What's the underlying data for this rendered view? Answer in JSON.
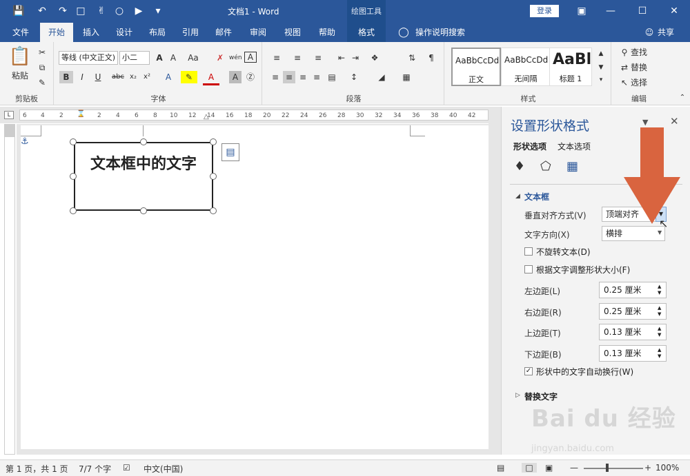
{
  "titlebar": {
    "title": "文档1  -  Word",
    "context_label": "绘图工具",
    "login": "登录",
    "quick_access": [
      "save-icon",
      "undo-icon",
      "redo-icon",
      "new-doc-icon",
      "touch-mode-icon",
      "shape-icon",
      "select-icon",
      "more-icon"
    ]
  },
  "tabs": [
    "文件",
    "开始",
    "插入",
    "设计",
    "布局",
    "引用",
    "邮件",
    "审阅",
    "视图",
    "帮助",
    "格式"
  ],
  "tell_me": "操作说明搜索",
  "share": "共享",
  "ribbon": {
    "clipboard": {
      "label": "剪贴板",
      "paste": "粘贴"
    },
    "font": {
      "label": "字体",
      "font_name": "等线 (中文正文)",
      "font_size": "小二"
    },
    "paragraph": {
      "label": "段落"
    },
    "styles": {
      "label": "样式",
      "items": [
        {
          "preview": "AaBbCcDd",
          "name": "正文"
        },
        {
          "preview": "AaBbCcDd",
          "name": "无间隔"
        },
        {
          "preview": "AaBl",
          "name": "标题 1"
        }
      ]
    },
    "editing": {
      "label": "编辑",
      "find": "查找",
      "replace": "替换",
      "select": "选择"
    }
  },
  "ruler_marks": [
    "6",
    "4",
    "2",
    "2",
    "4",
    "6",
    "8",
    "10",
    "12",
    "14",
    "16",
    "18",
    "20",
    "22",
    "24",
    "26",
    "28",
    "30",
    "32",
    "34",
    "36",
    "38",
    "40",
    "42"
  ],
  "textbox": {
    "text": "文本框中的文字"
  },
  "pane": {
    "title": "设置形状格式",
    "tab_shape": "形状选项",
    "tab_text": "文本选项",
    "section_textbox": "文本框",
    "vertical_align_label": "垂直对齐方式(V)",
    "vertical_align_value": "顶端对齐",
    "text_direction_label": "文字方向(X)",
    "text_direction_value": "横排",
    "no_rotate": "不旋转文本(D)",
    "no_rotate_checked": false,
    "autofit": "根据文字调整形状大小(F)",
    "autofit_checked": false,
    "left_margin_label": "左边距(L)",
    "left_margin": "0.25 厘米",
    "right_margin_label": "右边距(R)",
    "right_margin": "0.25 厘米",
    "top_margin_label": "上边距(T)",
    "top_margin": "0.13 厘米",
    "bottom_margin_label": "下边距(B)",
    "bottom_margin": "0.13 厘米",
    "wrap_text": "形状中的文字自动换行(W)",
    "wrap_text_checked": true,
    "section_alt": "替换文字"
  },
  "status": {
    "pages": "第 1 页，共 1 页",
    "words": "7/7 个字",
    "language": "中文(中国)",
    "zoom": "100%"
  },
  "watermark": {
    "brand": "Bai du 经验",
    "url": "jingyan.baidu.com"
  },
  "colors": {
    "accent": "#2b579a",
    "arrow": "#d9643f"
  }
}
